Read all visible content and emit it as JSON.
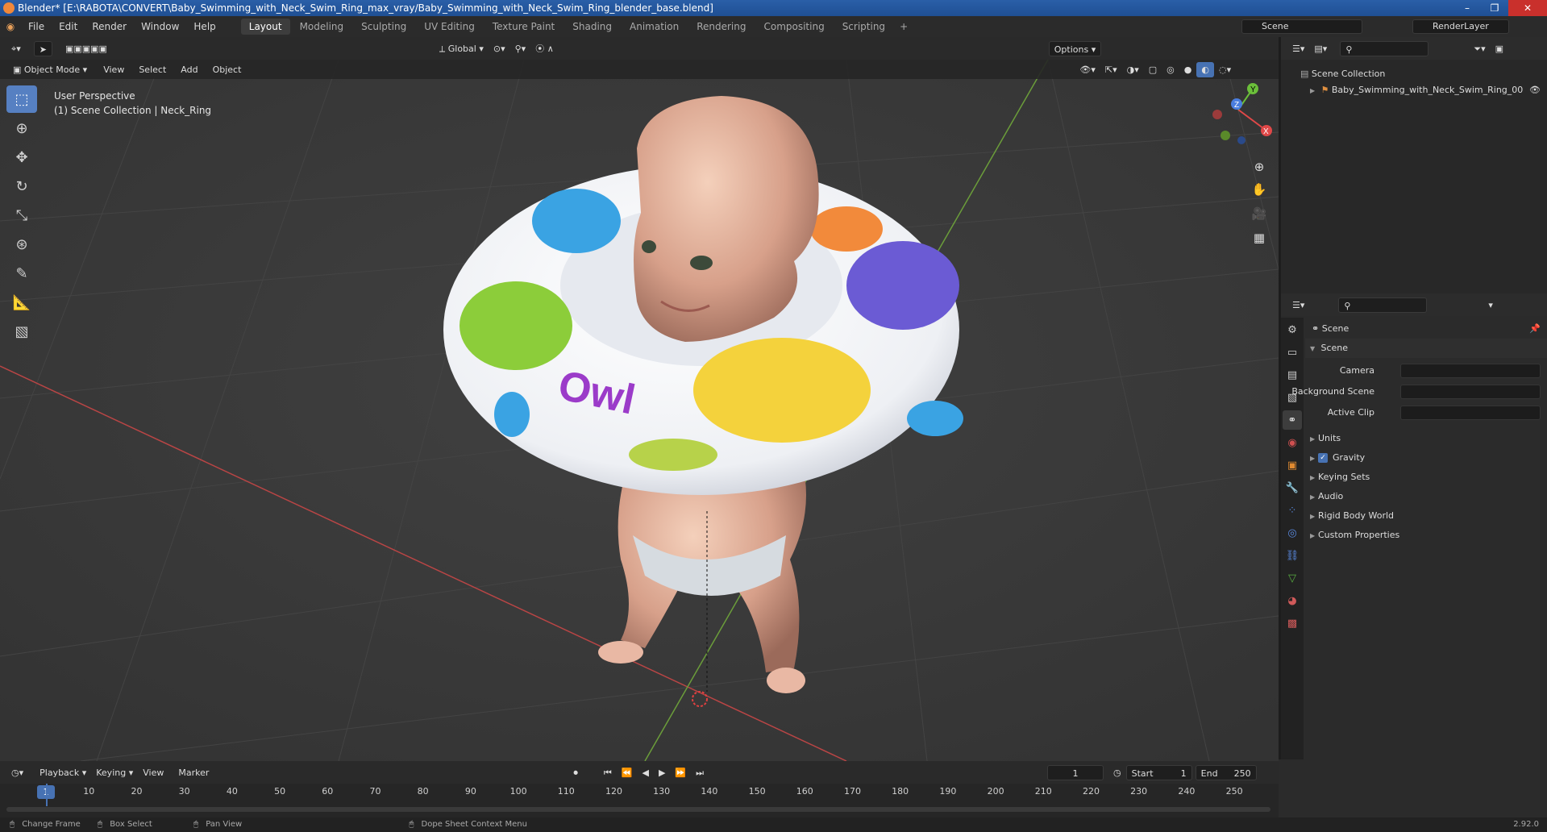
{
  "titlebar": {
    "title": "Blender* [E:\\RABOTA\\CONVERT\\Baby_Swimming_with_Neck_Swim_Ring_max_vray/Baby_Swimming_with_Neck_Swim_Ring_blender_base.blend]"
  },
  "menu": {
    "items": [
      "File",
      "Edit",
      "Render",
      "Window",
      "Help"
    ]
  },
  "workspaces": [
    "Layout",
    "Modeling",
    "Sculpting",
    "UV Editing",
    "Texture Paint",
    "Shading",
    "Animation",
    "Rendering",
    "Compositing",
    "Scripting"
  ],
  "scene_selector": {
    "value": "Scene"
  },
  "renderlayer_selector": {
    "value": "RenderLayer"
  },
  "viewport_header": {
    "orientation": "Global",
    "options_label": "Options",
    "mode": "Object Mode",
    "menus": [
      "View",
      "Select",
      "Add",
      "Object"
    ]
  },
  "viewport": {
    "perspective_label": "User Perspective",
    "collection_label": "(1) Scene Collection | Neck_Ring",
    "ring_text": "Owl",
    "gizmo_axes": {
      "x": "X",
      "y": "Y",
      "z": "Z"
    }
  },
  "outliner": {
    "root": "Scene Collection",
    "item": "Baby_Swimming_with_Neck_Swim_Ring_00"
  },
  "properties": {
    "context": "Scene",
    "panel_title": "Scene",
    "fields": [
      {
        "label": "Camera"
      },
      {
        "label": "Background Scene"
      },
      {
        "label": "Active Clip"
      }
    ],
    "sections": [
      "Units",
      "Gravity",
      "Keying Sets",
      "Audio",
      "Rigid Body World",
      "Custom Properties"
    ]
  },
  "timeline": {
    "menus": [
      "Playback",
      "Keying",
      "View",
      "Marker"
    ],
    "current_frame": "1",
    "start_label": "Start",
    "start_value": "1",
    "end_label": "End",
    "end_value": "250",
    "ruler_current": "1",
    "ticks": [
      "10",
      "20",
      "30",
      "40",
      "50",
      "60",
      "70",
      "80",
      "90",
      "100",
      "110",
      "120",
      "130",
      "140",
      "150",
      "160",
      "170",
      "180",
      "190",
      "200",
      "210",
      "220",
      "230",
      "240",
      "250"
    ]
  },
  "statusbar": {
    "items": [
      "Change Frame",
      "Box Select",
      "Pan View",
      "Dope Sheet Context Menu"
    ],
    "version": "2.92.0"
  }
}
